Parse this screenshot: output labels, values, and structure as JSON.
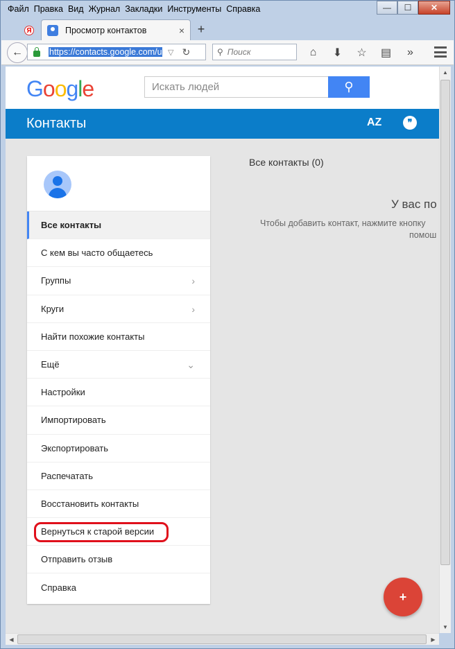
{
  "menubar": [
    "Файл",
    "Правка",
    "Вид",
    "Журнал",
    "Закладки",
    "Инструменты",
    "Справка"
  ],
  "window_controls": {
    "minimize": "—",
    "maximize": "☐",
    "close": "✕"
  },
  "tab": {
    "title": "Просмотр контактов",
    "mini_label": "Я",
    "close": "×",
    "new_tab": "+"
  },
  "nav": {
    "url": "https://contacts.google.com/u",
    "search_placeholder": "Поиск"
  },
  "google": {
    "logo": [
      "G",
      "o",
      "o",
      "g",
      "l",
      "e"
    ],
    "logo_colors": [
      "#4285f4",
      "#ea4335",
      "#fbbc05",
      "#4285f4",
      "#34a853",
      "#ea4335"
    ],
    "search_placeholder": "Искать людей"
  },
  "appbar": {
    "title": "Контакты",
    "sort_label": "AZ",
    "accent": "#0b7dc9"
  },
  "sidebar": {
    "items": [
      {
        "label": "Все контакты",
        "active": true
      },
      {
        "label": "С кем вы часто общаетесь"
      },
      {
        "label": "Группы",
        "chevron": "›"
      },
      {
        "label": "Круги",
        "chevron": "›"
      },
      {
        "label": "Найти похожие контакты"
      },
      {
        "label": "Ещё",
        "chevron": "⌄"
      },
      {
        "label": "Настройки"
      },
      {
        "label": "Импортировать"
      },
      {
        "label": "Экспортировать"
      },
      {
        "label": "Распечатать"
      },
      {
        "label": "Восстановить контакты"
      },
      {
        "label": "Вернуться к старой версии",
        "highlighted": true
      },
      {
        "label": "Отправить отзыв"
      },
      {
        "label": "Справка"
      }
    ]
  },
  "main": {
    "all_contacts": "Все контакты (0)",
    "empty_title": "У вас по",
    "empty_line1": "Чтобы добавить контакт, нажмите кнопку",
    "empty_line2": "помош"
  },
  "fab": {
    "label": "+",
    "color": "#db4437"
  }
}
